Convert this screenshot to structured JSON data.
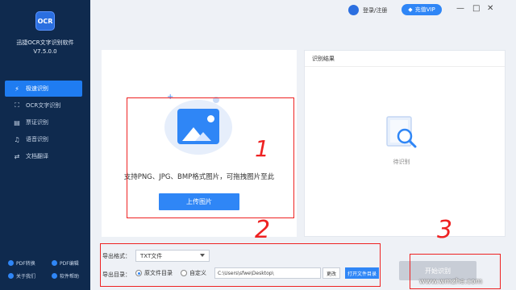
{
  "app": {
    "logo_text": "OCR",
    "name": "迅捷OCR文字识别软件",
    "version": "V7.5.0.0"
  },
  "sidebar": {
    "items": [
      {
        "label": "极速识别",
        "icon": "lightning-icon",
        "active": true
      },
      {
        "label": "OCR文字识别",
        "icon": "scan-icon",
        "active": false
      },
      {
        "label": "票证识别",
        "icon": "ticket-icon",
        "active": false
      },
      {
        "label": "语音识别",
        "icon": "microphone-icon",
        "active": false
      },
      {
        "label": "文档翻译",
        "icon": "translate-icon",
        "active": false
      }
    ],
    "bottom_links": [
      {
        "label": "PDF转换"
      },
      {
        "label": "PDF编辑"
      },
      {
        "label": "关于我们"
      },
      {
        "label": "软件帮助"
      }
    ]
  },
  "topbar": {
    "login_label": "登录/注册",
    "vip_label": "充值VIP",
    "minimize": "—",
    "maximize": "□",
    "close": "✕"
  },
  "upload": {
    "hint": "支持PNG、JPG、BMP格式图片，可拖拽图片至此",
    "button": "上传图片"
  },
  "result": {
    "title": "识别结果",
    "placeholder": "待识别"
  },
  "export": {
    "format_label": "导出格式：",
    "format_value": "TXT文件",
    "dir_label": "导出目录：",
    "radio_source": "原文件目录",
    "radio_custom": "自定义",
    "path_value": "C:\\Users\\sfwe\\Desktop\\",
    "change_button": "更改",
    "open_button": "打开文件目录",
    "start_button": "开始识别"
  },
  "annotations": [
    "1",
    "2",
    "3"
  ],
  "watermark": "www.wmzhe.com",
  "colors": {
    "sidebar_bg": "#0f2a4e",
    "accent": "#2f86f6",
    "annotation_red": "#e22222"
  }
}
